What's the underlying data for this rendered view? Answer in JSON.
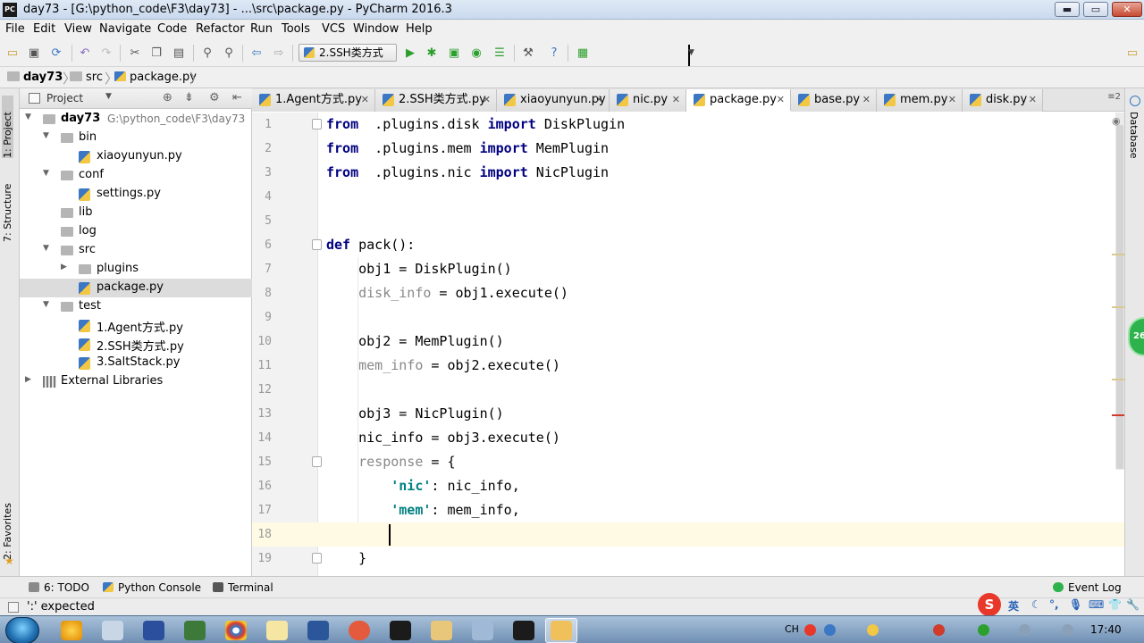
{
  "window": {
    "app_icon": "PC",
    "title": "day73 - [G:\\python_code\\F3\\day73] - ...\\src\\package.py - PyCharm 2016.3",
    "minimize": "▬",
    "maximize": "▭",
    "close": "✕"
  },
  "menu": [
    "File",
    "Edit",
    "View",
    "Navigate",
    "Code",
    "Refactor",
    "Run",
    "Tools",
    "VCS",
    "Window",
    "Help"
  ],
  "toolbar": {
    "run_config": "2.SSH类方式",
    "icons": [
      "open-icon",
      "save-icon",
      "sync-icon",
      "undo-icon",
      "redo-icon",
      "cut-icon",
      "copy-icon",
      "paste-icon",
      "find-icon",
      "replace-icon",
      "back-icon",
      "forward-icon",
      "run-icon",
      "debug-icon",
      "coverage-icon",
      "profile-icon",
      "concurrency-icon",
      "settings-icon",
      "help-icon",
      "structure-icon"
    ]
  },
  "breadcrumb": [
    "day73",
    "src",
    "package.py"
  ],
  "left_strip": {
    "project_tab": "1: Project",
    "structure_tab": "7: Structure",
    "favorites_tab": "2: Favorites"
  },
  "right_strip": {
    "database_tab": "Database",
    "badge": "26"
  },
  "project_panel": {
    "title": "Project",
    "tree": [
      {
        "label": "day73",
        "path": "G:\\python_code\\F3\\day73",
        "type": "folder",
        "level": 0,
        "expanded": true
      },
      {
        "label": "bin",
        "type": "folder",
        "level": 1,
        "expanded": true
      },
      {
        "label": "xiaoyunyun.py",
        "type": "py",
        "level": 2
      },
      {
        "label": "conf",
        "type": "folder",
        "level": 1,
        "expanded": true
      },
      {
        "label": "settings.py",
        "type": "py",
        "level": 2
      },
      {
        "label": "lib",
        "type": "folder",
        "level": 1
      },
      {
        "label": "log",
        "type": "folder",
        "level": 1
      },
      {
        "label": "src",
        "type": "folder",
        "level": 1,
        "expanded": true
      },
      {
        "label": "plugins",
        "type": "folder",
        "level": 2,
        "collapsed": true
      },
      {
        "label": "package.py",
        "type": "py",
        "level": 2,
        "selected": true
      },
      {
        "label": "test",
        "type": "folder",
        "level": 1,
        "expanded": true
      },
      {
        "label": "1.Agent方式.py",
        "type": "py",
        "level": 2
      },
      {
        "label": "2.SSH类方式.py",
        "type": "py",
        "level": 2
      },
      {
        "label": "3.SaltStack.py",
        "type": "py",
        "level": 2
      },
      {
        "label": "External Libraries",
        "type": "lib",
        "level": 0,
        "collapsed": true
      }
    ]
  },
  "tabs": [
    {
      "label": "1.Agent方式.py"
    },
    {
      "label": "2.SSH类方式.py"
    },
    {
      "label": "xiaoyunyun.py"
    },
    {
      "label": "nic.py"
    },
    {
      "label": "package.py",
      "active": true
    },
    {
      "label": "base.py"
    },
    {
      "label": "mem.py"
    },
    {
      "label": "disk.py"
    }
  ],
  "tabs_more": "≡2",
  "editor": {
    "current_line": 18,
    "lines": [
      {
        "n": "1",
        "tokens": [
          [
            "kw",
            "from"
          ],
          [
            "",
            "  .plugins.disk "
          ],
          [
            "kw",
            "import"
          ],
          [
            "",
            " DiskPlugin"
          ]
        ]
      },
      {
        "n": "2",
        "tokens": [
          [
            "kw",
            "from"
          ],
          [
            "",
            "  .plugins.mem "
          ],
          [
            "kw",
            "import"
          ],
          [
            "",
            " MemPlugin"
          ]
        ]
      },
      {
        "n": "3",
        "tokens": [
          [
            "kw",
            "from"
          ],
          [
            "",
            "  .plugins.nic "
          ],
          [
            "kw",
            "import"
          ],
          [
            "",
            " NicPlugin"
          ]
        ]
      },
      {
        "n": "4",
        "tokens": []
      },
      {
        "n": "5",
        "tokens": []
      },
      {
        "n": "6",
        "tokens": [
          [
            "kw",
            "def"
          ],
          [
            "",
            " pack():"
          ]
        ]
      },
      {
        "n": "7",
        "tokens": [
          [
            "",
            "    obj1 = DiskPlugin()"
          ]
        ]
      },
      {
        "n": "8",
        "tokens": [
          [
            "dim",
            "    disk_info"
          ],
          [
            "",
            " = obj1.execute()"
          ]
        ]
      },
      {
        "n": "9",
        "tokens": []
      },
      {
        "n": "10",
        "tokens": [
          [
            "",
            "    obj2 = MemPlugin()"
          ]
        ]
      },
      {
        "n": "11",
        "tokens": [
          [
            "dim",
            "    mem_info"
          ],
          [
            "",
            " = obj2.execute()"
          ]
        ]
      },
      {
        "n": "12",
        "tokens": []
      },
      {
        "n": "13",
        "tokens": [
          [
            "",
            "    obj3 = NicPlugin()"
          ]
        ]
      },
      {
        "n": "14",
        "tokens": [
          [
            "",
            "    nic_info = obj3.execute()"
          ]
        ]
      },
      {
        "n": "15",
        "tokens": [
          [
            "dim",
            "    response"
          ],
          [
            "",
            " = {"
          ]
        ]
      },
      {
        "n": "16",
        "tokens": [
          [
            "",
            "        "
          ],
          [
            "str",
            "'nic'"
          ],
          [
            "",
            ": nic_info,"
          ]
        ]
      },
      {
        "n": "17",
        "tokens": [
          [
            "",
            "        "
          ],
          [
            "str",
            "'mem'"
          ],
          [
            "",
            ": mem_info,"
          ]
        ]
      },
      {
        "n": "18",
        "tokens": [
          [
            "",
            "        "
          ]
        ]
      },
      {
        "n": "19",
        "tokens": [
          [
            "",
            "    }"
          ]
        ]
      }
    ]
  },
  "bottom_tools": [
    {
      "label": "6: TODO",
      "color": "#8a8a8a"
    },
    {
      "label": "Python Console",
      "color": "#3b77c4"
    },
    {
      "label": "Terminal",
      "color": "#555555"
    }
  ],
  "event_log": "Event Log",
  "status": {
    "text": "':' expected"
  },
  "taskbar": {
    "tray_lang": "CH",
    "ime": "英",
    "clock": "17:40"
  },
  "colors": {
    "keyword": "#000080",
    "string": "#008080",
    "current_line": "#fffae3",
    "selection": "#dcdcdc"
  }
}
